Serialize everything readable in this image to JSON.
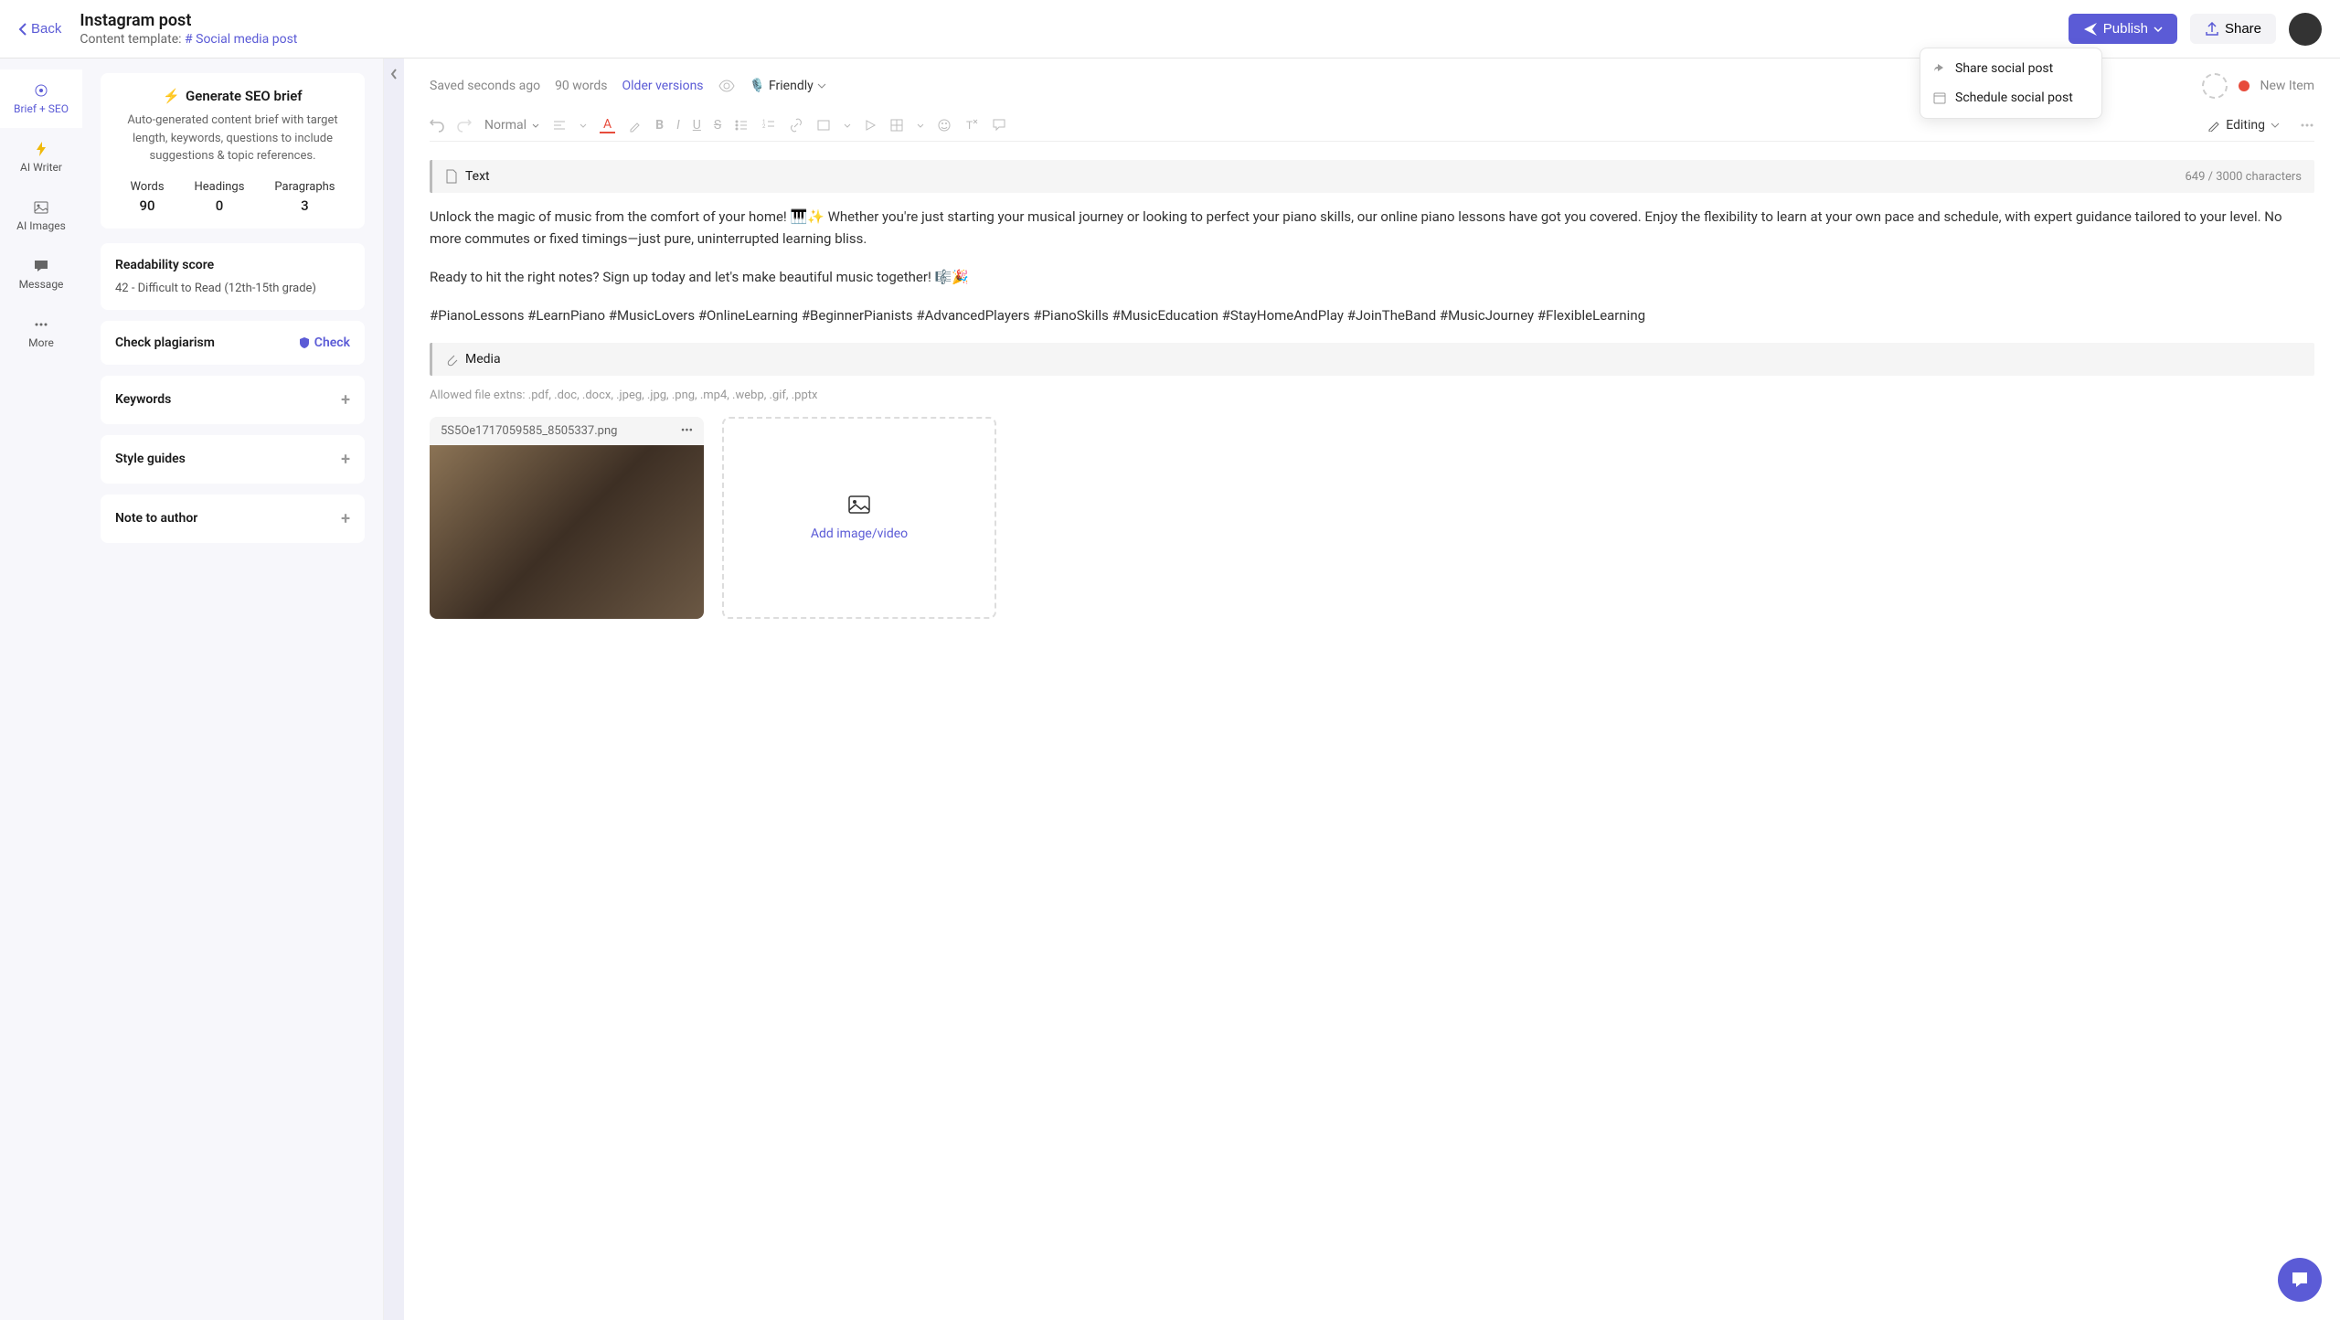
{
  "header": {
    "back_label": "Back",
    "title": "Instagram post",
    "template_label": "Content template:",
    "template_link": "Social media post",
    "publish_label": "Publish",
    "share_label": "Share",
    "dropdown": {
      "share_post": "Share social post",
      "schedule_post": "Schedule social post"
    }
  },
  "rail": {
    "brief": "Brief + SEO",
    "writer": "AI Writer",
    "images": "AI Images",
    "message": "Message",
    "more": "More"
  },
  "sidebar": {
    "seo": {
      "title": "Generate SEO brief",
      "desc": "Auto-generated content brief with target length, keywords, questions to include suggestions & topic references.",
      "words_label": "Words",
      "words_val": "90",
      "headings_label": "Headings",
      "headings_val": "0",
      "paragraphs_label": "Paragraphs",
      "paragraphs_val": "3"
    },
    "readability": {
      "title": "Readability score",
      "score": "42 - Difficult to Read (12th-15th grade)"
    },
    "plagiarism": {
      "title": "Check plagiarism",
      "check": "Check"
    },
    "keywords": "Keywords",
    "style_guides": "Style guides",
    "note": "Note to author"
  },
  "editor": {
    "saved": "Saved seconds ago",
    "word_count": "90 words",
    "older_versions": "Older versions",
    "tone": "Friendly",
    "status_label": "New Item",
    "normal": "Normal",
    "editing": "Editing",
    "text_block": "Text",
    "char_count": "649 / 3000 characters",
    "body1": "Unlock the magic of music from the comfort of your home! 🎹✨ Whether you're just starting your musical journey or looking to perfect your piano skills, our online piano lessons have got you covered. Enjoy the flexibility to learn at your own pace and schedule, with expert guidance tailored to your level. No more commutes or fixed timings—just pure, uninterrupted learning bliss.",
    "body2": "Ready to hit the right notes? Sign up today and let's make beautiful music together! 🎼🎉",
    "hashtags": "#PianoLessons #LearnPiano #MusicLovers #OnlineLearning #BeginnerPianists #AdvancedPlayers #PianoSkills #MusicEducation #StayHomeAndPlay #JoinTheBand #MusicJourney #FlexibleLearning",
    "media_block": "Media",
    "allowed_ext": "Allowed file extns: .pdf, .doc, .docx, .jpeg, .jpg, .png, .mp4, .webp, .gif, .pptx",
    "media_filename": "5S5Oe1717059585_8505337.png",
    "add_media": "Add image/video"
  }
}
